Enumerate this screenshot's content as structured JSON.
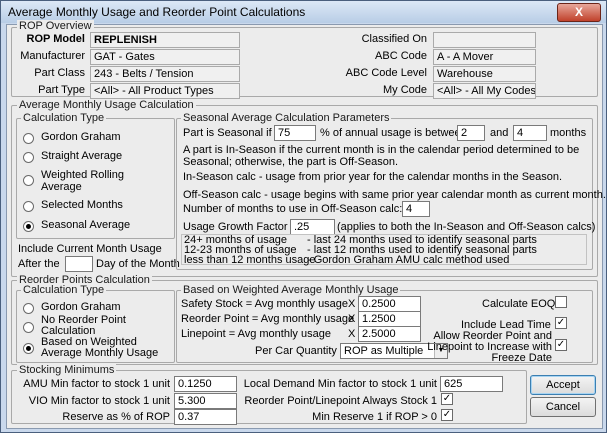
{
  "window": {
    "title": "Average Monthly Usage and Reorder Point Calculations",
    "close_glyph": "X"
  },
  "rop_overview": {
    "group_title": "ROP Overview",
    "rop_model_label": "ROP Model",
    "rop_model_value": "REPLENISH",
    "classified_on_label": "Classified On",
    "classified_on_value": "",
    "manufacturer_label": "Manufacturer",
    "manufacturer_value": "GAT - Gates",
    "abc_code_label": "ABC Code",
    "abc_code_value": "A - A Mover",
    "part_class_label": "Part Class",
    "part_class_value": "243 - Belts / Tension",
    "abc_code_level_label": "ABC Code Level",
    "abc_code_level_value": "Warehouse",
    "part_type_label": "Part Type",
    "part_type_value": "<All> - All Product Types",
    "my_code_label": "My Code",
    "my_code_value": "<All> - All My Codes"
  },
  "amu_calc": {
    "group_title": "Average Monthly Usage Calculation",
    "calc_type_title": "Calculation Type",
    "options": [
      "Gordon Graham",
      "Straight Average",
      "Weighted Rolling Average",
      "Selected Months",
      "Seasonal Average"
    ],
    "selected_index": 4,
    "include_current_month_label": "Include Current Month Usage",
    "after_the_label": "After the",
    "after_the_value": "",
    "day_of_month_label": "Day of the Month",
    "seasonal": {
      "title": "Seasonal Average Calculation Parameters",
      "seasonal_if_label": "Part is Seasonal if",
      "seasonal_pct_value": "75",
      "annual_usage_label": "% of annual usage is between",
      "between_from_value": "2",
      "and_label": "and",
      "between_to_value": "4",
      "months_label": "months",
      "in_season_text": "A part is In-Season if the current month is in the calendar period determined to be Seasonal; otherwise, the part is Off-Season.",
      "in_season_calc_text": "In-Season calc - usage from prior year for the calendar months in the Season.",
      "off_season_calc_text": "Off-Season calc - usage begins with same prior year calendar month as current month.",
      "off_season_months_label": "Number of months to use in Off-Season calc:",
      "off_season_months_value": "4",
      "growth_factor_label": "Usage Growth Factor",
      "growth_factor_value": ".25",
      "growth_factor_note": "(applies to both the In-Season and Off-Season calcs)",
      "rules": [
        {
          "a": "24+ months of usage",
          "b": "- last 24 months used to identify seasonal parts"
        },
        {
          "a": "12-23 months of usage",
          "b": "- last 12 months used to identify seasonal parts"
        },
        {
          "a": "less than 12 months usage",
          "b": "- Gordon Graham AMU calc method used"
        }
      ]
    }
  },
  "reorder_calc": {
    "group_title": "Reorder Points Calculation",
    "calc_type_title": "Calculation Type",
    "options": [
      "Gordon Graham",
      "No Reorder Point Calculation",
      "Based on Weighted Average Monthly Usage"
    ],
    "selected_index": 2,
    "weighted": {
      "title": "Based on Weighted Average Monthly Usage",
      "safety_stock_label": "Safety Stock = Avg monthly usage",
      "safety_stock_value": "0.2500",
      "reorder_point_label": "Reorder Point = Avg monthly usage",
      "reorder_point_value": "1.2500",
      "linepoint_label": "Linepoint = Avg monthly usage",
      "linepoint_value": "2.5000",
      "x_label": "X",
      "per_car_label": "Per Car Quantity",
      "per_car_value": "ROP as Multiple",
      "calculate_eoq_label": "Calculate EOQ",
      "calculate_eoq_checked": false,
      "include_lead_time_label": "Include Lead Time",
      "include_lead_time_checked": true,
      "allow_increase_label": "Allow Reorder Point and Linepoint to Increase with Freeze Date",
      "allow_increase_checked": true
    }
  },
  "stocking": {
    "group_title": "Stocking Minimums",
    "amu_min_label": "AMU Min factor to stock 1 unit",
    "amu_min_value": "0.1250",
    "vio_min_label": "VIO Min factor to stock 1 unit",
    "vio_min_value": "5.300",
    "reserve_label": "Reserve as % of ROP",
    "reserve_value": "0.37",
    "local_demand_label": "Local Demand Min factor to stock 1 unit",
    "local_demand_value": "625",
    "always_stock_label": "Reorder Point/Linepoint Always Stock 1",
    "always_stock_checked": true,
    "min_reserve_label": "Min Reserve 1 if ROP > 0",
    "min_reserve_checked": true
  },
  "buttons": {
    "accept": "Accept",
    "cancel": "Cancel"
  },
  "check_glyph": "✓",
  "colors": {
    "title_bar": "#c3d5ea",
    "close_button": "#c0412b",
    "dialog_bg": "#ececec"
  }
}
